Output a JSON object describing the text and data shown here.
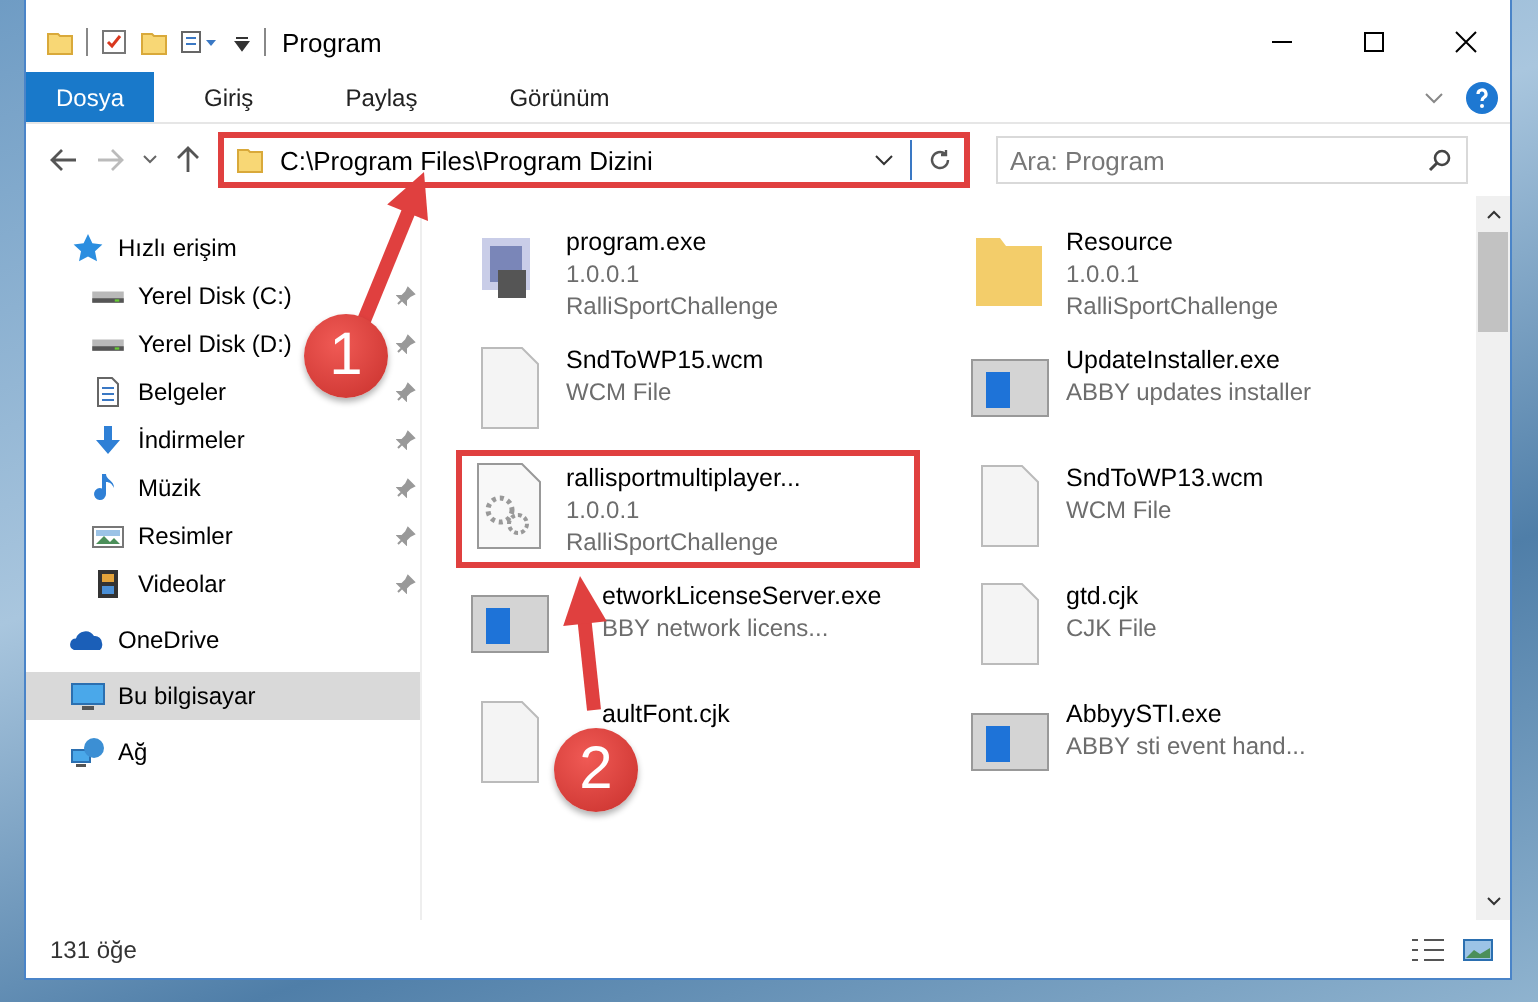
{
  "window": {
    "title": "Program"
  },
  "ribbon_tabs": [
    {
      "label": "Dosya",
      "selected": true
    },
    {
      "label": "Giriş",
      "selected": false
    },
    {
      "label": "Paylaş",
      "selected": false
    },
    {
      "label": "Görünüm",
      "selected": false
    }
  ],
  "address": {
    "path": "C:\\Program Files\\Program Dizini",
    "highlighted": true
  },
  "search": {
    "placeholder": "Ara: Program"
  },
  "sidebar": {
    "items": [
      {
        "label": "Hızlı erişim",
        "kind": "star",
        "pinned": false,
        "selected": false,
        "children": [
          {
            "label": "Yerel Disk (C:)",
            "kind": "drive",
            "pinned": true,
            "selected": false
          },
          {
            "label": "Yerel Disk (D:)",
            "kind": "drive",
            "pinned": true,
            "selected": false
          },
          {
            "label": "Belgeler",
            "kind": "doc",
            "pinned": true,
            "selected": false
          },
          {
            "label": "İndirmeler",
            "kind": "download",
            "pinned": true,
            "selected": false
          },
          {
            "label": "Müzik",
            "kind": "music",
            "pinned": true,
            "selected": false
          },
          {
            "label": "Resimler",
            "kind": "image",
            "pinned": true,
            "selected": false
          },
          {
            "label": "Videolar",
            "kind": "video",
            "pinned": true,
            "selected": false
          }
        ]
      },
      {
        "label": "OneDrive",
        "kind": "cloud",
        "pinned": false,
        "selected": false
      },
      {
        "label": "Bu bilgisayar",
        "kind": "pc",
        "pinned": false,
        "selected": true
      },
      {
        "label": "Ağ",
        "kind": "network",
        "pinned": false,
        "selected": false
      }
    ]
  },
  "files": [
    {
      "name": "program.exe",
      "details": [
        "1.0.0.1",
        "RalliSportChallenge"
      ],
      "kind": "exe",
      "highlighted": false,
      "covered": false
    },
    {
      "name": "Resource",
      "details": [
        "1.0.0.1",
        "RalliSportChallenge"
      ],
      "kind": "folder",
      "highlighted": false,
      "covered": false
    },
    {
      "name": "SndToWP15.wcm",
      "details": [
        "WCM File"
      ],
      "kind": "doc",
      "highlighted": false,
      "covered": false
    },
    {
      "name": "UpdateInstaller.exe",
      "details": [
        "ABBY updates installer"
      ],
      "kind": "app",
      "highlighted": false,
      "covered": false
    },
    {
      "name": "rallisportmultiplayer...",
      "details": [
        "1.0.0.1",
        "RalliSportChallenge"
      ],
      "kind": "settings",
      "highlighted": true,
      "covered": false
    },
    {
      "name": "SndToWP13.wcm",
      "details": [
        "WCM File"
      ],
      "kind": "doc",
      "highlighted": false,
      "covered": false
    },
    {
      "name": "etworkLicenseServer.exe",
      "details": [
        "BBY network licens..."
      ],
      "kind": "app",
      "highlighted": false,
      "covered": true
    },
    {
      "name": "gtd.cjk",
      "details": [
        "CJK File"
      ],
      "kind": "doc",
      "highlighted": false,
      "covered": false
    },
    {
      "name": "aultFont.cjk",
      "kind": "doc",
      "highlighted": false,
      "covered": true
    },
    {
      "name": "AbbyySTI.exe",
      "details": [
        "ABBY sti event hand..."
      ],
      "kind": "app",
      "highlighted": false,
      "covered": false
    }
  ],
  "status_bar": {
    "count": "131 öğe"
  },
  "annotations": [
    {
      "number": "1"
    },
    {
      "number": "2"
    }
  ]
}
